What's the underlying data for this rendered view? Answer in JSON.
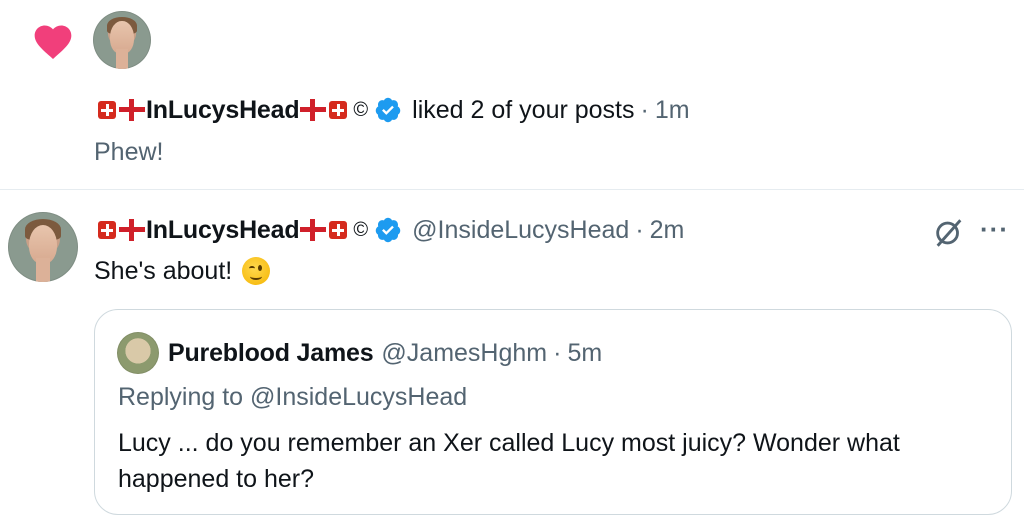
{
  "notification": {
    "display_name": "InLucysHead",
    "copyright_mark": "©",
    "action_text": "liked 2 of your posts",
    "separator": "·",
    "time": "1m",
    "snippet": "Phew!"
  },
  "post": {
    "display_name": "InLucysHead",
    "copyright_mark": "©",
    "handle": "@InsideLucysHead",
    "separator": "·",
    "time": "2m",
    "text": "She's about!",
    "emoji": "wink-emoji",
    "more_label": "···"
  },
  "quote": {
    "display_name": "Pureblood James",
    "handle": "@JamesHghm",
    "separator": "·",
    "time": "5m",
    "replying_to": "Replying to @InsideLucysHead",
    "text_line1": "Lucy ... do you remember an Xer called Lucy most juicy? Wonder what",
    "text_line2": "happened to her?"
  },
  "colors": {
    "heart": "#f13f7b",
    "verified": "#1d9bf0",
    "muted": "#536471",
    "flag_red": "#d52b1e"
  }
}
